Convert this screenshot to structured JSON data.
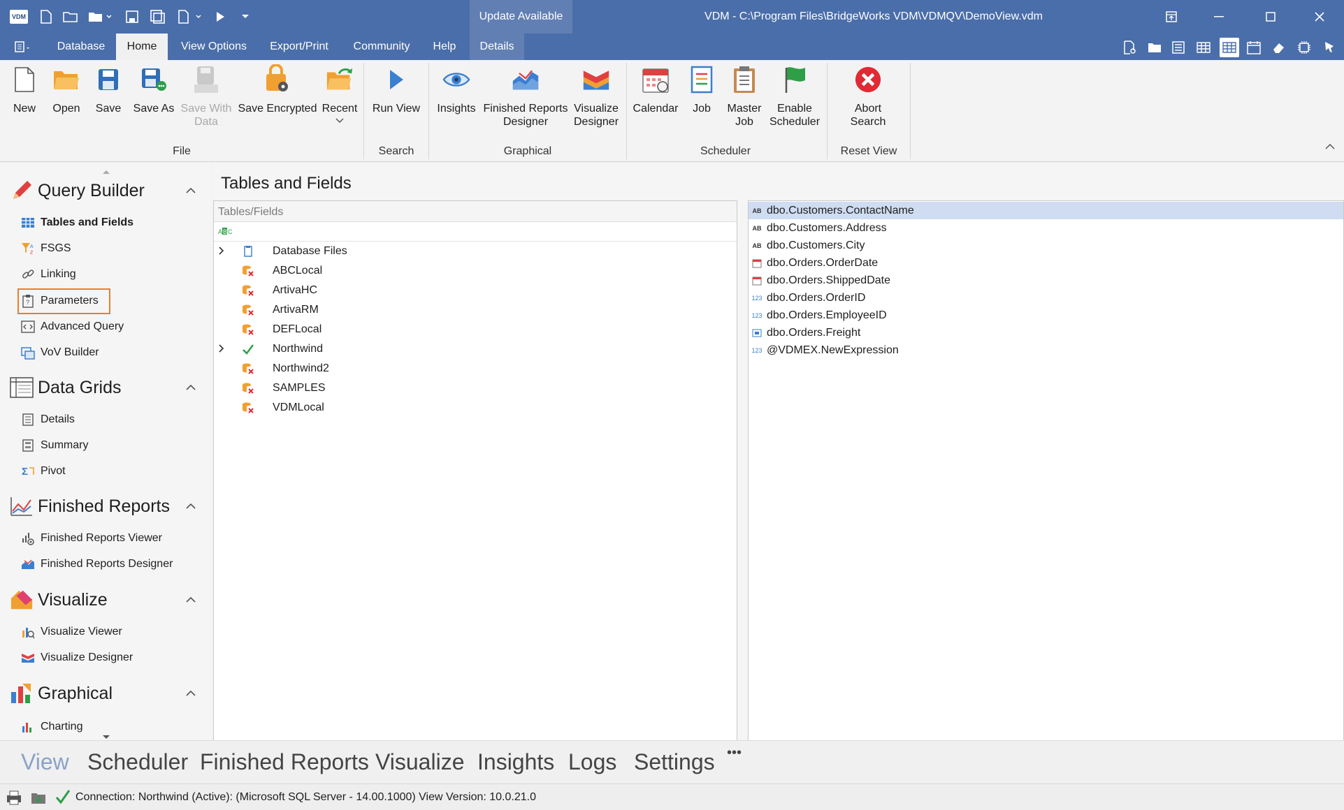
{
  "titlebar": {
    "update_label": "Update Available",
    "window_title": "VDM - C:\\Program Files\\BridgeWorks VDM\\VDMQV\\DemoView.vdm",
    "logo_text": "VDM"
  },
  "menu": {
    "tabs": [
      "Database",
      "Home",
      "View Options",
      "Export/Print",
      "Community",
      "Help",
      "Details"
    ],
    "active_tab": "Home"
  },
  "ribbon": {
    "file": {
      "label": "File",
      "new": "New",
      "open": "Open",
      "save": "Save",
      "save_as": "Save As",
      "save_with_data_1": "Save With",
      "save_with_data_2": "Data",
      "save_encrypted": "Save Encrypted",
      "recent": "Recent"
    },
    "search": {
      "label": "Search",
      "run_view": "Run View"
    },
    "graphical": {
      "label": "Graphical",
      "insights": "Insights",
      "frd_1": "Finished Reports",
      "frd_2": "Designer",
      "vd_1": "Visualize",
      "vd_2": "Designer"
    },
    "scheduler": {
      "label": "Scheduler",
      "calendar": "Calendar",
      "job": "Job",
      "master_1": "Master",
      "master_2": "Job",
      "enable_1": "Enable",
      "enable_2": "Scheduler"
    },
    "reset": {
      "label": "Reset View",
      "abort_1": "Abort",
      "abort_2": "Search"
    }
  },
  "nav": {
    "query_builder": {
      "title": "Query Builder",
      "items": [
        "Tables and Fields",
        "FSGS",
        "Linking",
        "Parameters",
        "Advanced Query",
        "VoV Builder"
      ]
    },
    "data_grids": {
      "title": "Data Grids",
      "items": [
        "Details",
        "Summary",
        "Pivot"
      ]
    },
    "finished_reports": {
      "title": "Finished Reports",
      "items": [
        "Finished Reports Viewer",
        "Finished Reports Designer"
      ]
    },
    "visualize": {
      "title": "Visualize",
      "items": [
        "Visualize Viewer",
        "Visualize Designer"
      ]
    },
    "graphical": {
      "title": "Graphical",
      "items": [
        "Charting"
      ]
    }
  },
  "main": {
    "title": "Tables and Fields",
    "tree_header": "Tables/Fields",
    "tree": [
      {
        "label": "Database Files",
        "expandable": true,
        "status": "file"
      },
      {
        "label": "ABCLocal",
        "expandable": false,
        "status": "error"
      },
      {
        "label": "ArtivaHC",
        "expandable": false,
        "status": "error"
      },
      {
        "label": "ArtivaRM",
        "expandable": false,
        "status": "error"
      },
      {
        "label": "DEFLocal",
        "expandable": false,
        "status": "error"
      },
      {
        "label": "Northwind",
        "expandable": true,
        "status": "active"
      },
      {
        "label": "Northwind2",
        "expandable": false,
        "status": "error"
      },
      {
        "label": "SAMPLES",
        "expandable": false,
        "status": "error"
      },
      {
        "label": "VDMLocal",
        "expandable": false,
        "status": "error"
      }
    ],
    "fields": [
      {
        "label": "dbo.Customers.ContactName",
        "type": "text",
        "icon_text": "AB",
        "selected": true
      },
      {
        "label": "dbo.Customers.Address",
        "type": "text",
        "icon_text": "AB",
        "selected": false
      },
      {
        "label": "dbo.Customers.City",
        "type": "text",
        "icon_text": "AB",
        "selected": false
      },
      {
        "label": "dbo.Orders.OrderDate",
        "type": "date",
        "icon_text": "",
        "selected": false
      },
      {
        "label": "dbo.Orders.ShippedDate",
        "type": "date",
        "icon_text": "",
        "selected": false
      },
      {
        "label": "dbo.Orders.OrderID",
        "type": "number",
        "icon_text": "123",
        "selected": false
      },
      {
        "label": "dbo.Orders.EmployeeID",
        "type": "number",
        "icon_text": "123",
        "selected": false
      },
      {
        "label": "dbo.Orders.Freight",
        "type": "currency",
        "icon_text": "1.2",
        "selected": false
      },
      {
        "label": "@VDMEX.NewExpression",
        "type": "number",
        "icon_text": "123",
        "selected": false
      }
    ]
  },
  "bottom_tabs": [
    "View",
    "Scheduler",
    "Finished Reports",
    "Visualize",
    "Insights",
    "Logs",
    "Settings",
    "•••"
  ],
  "status": {
    "text": "Connection: Northwind (Active): (Microsoft SQL Server - 14.00.1000) View Version: 10.0.21.0"
  },
  "colors": {
    "titlebar": "#4a6ea9",
    "accent_highlight": "#ee7d22",
    "selected_row": "#cfdcf2",
    "active_bottom_tab": "#8aa2c9"
  }
}
